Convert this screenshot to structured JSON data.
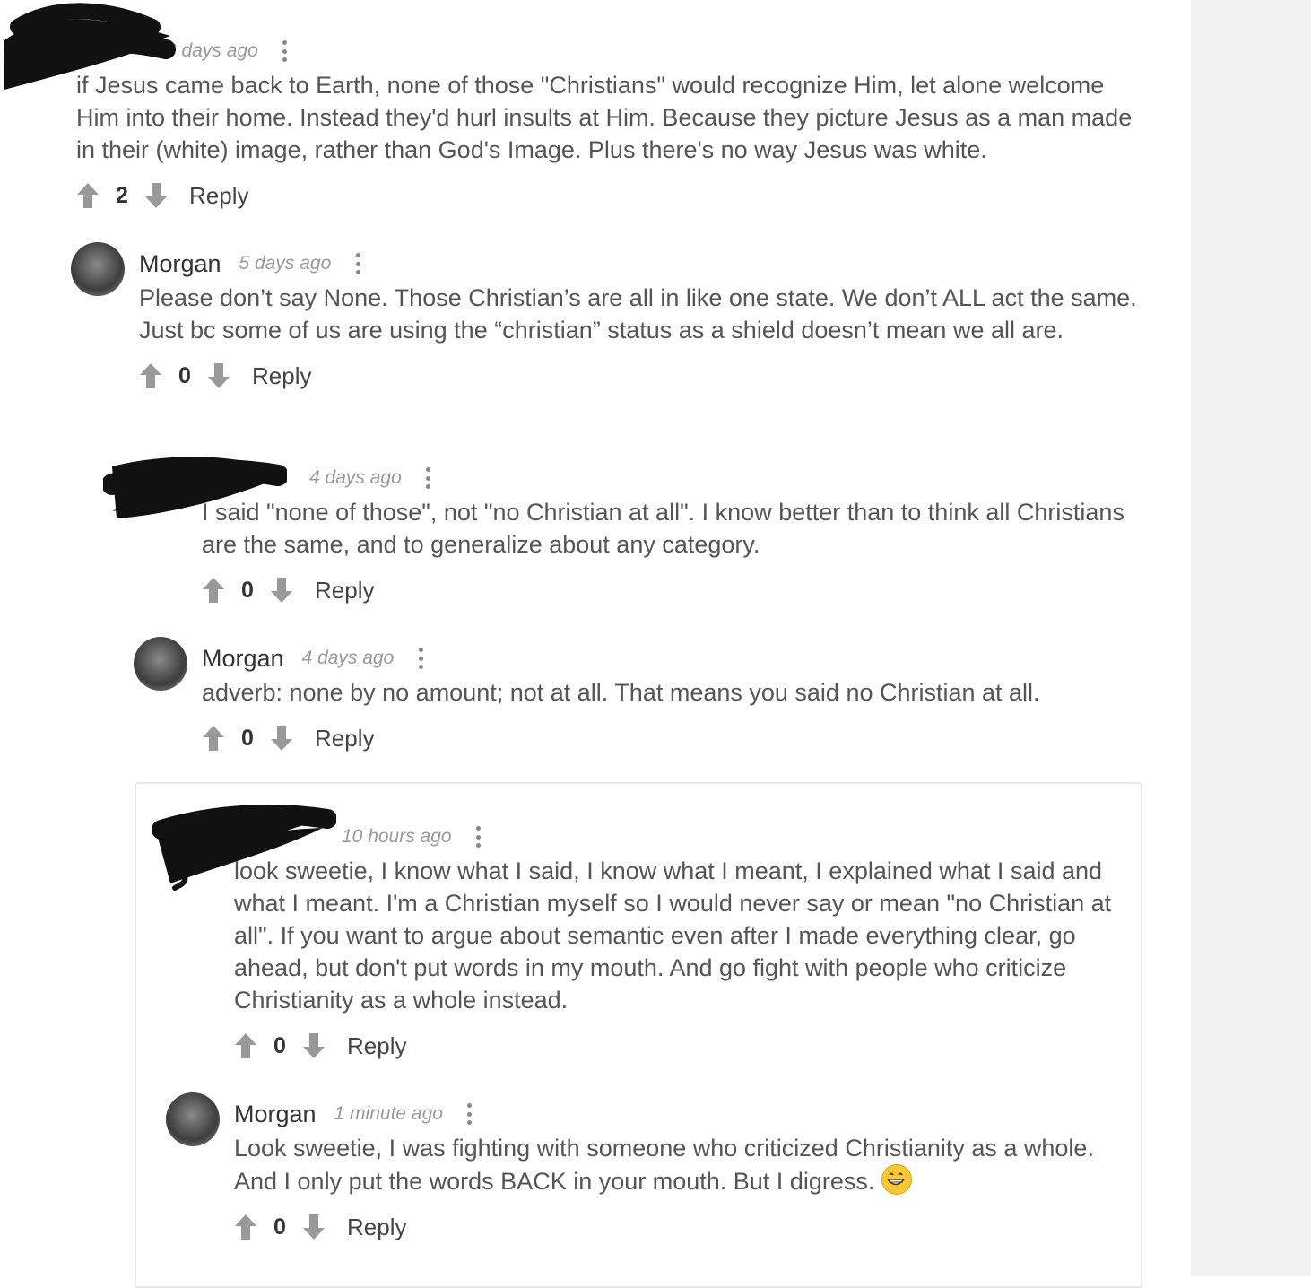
{
  "comments": [
    {
      "author": "",
      "time": "6 days ago",
      "body": "if Jesus came back to Earth, none of those \"Christians\" would recognize Him, let alone welcome Him into their home. Instead they'd hurl insults at Him. Because they picture Jesus as a man made in their (white) image, rather than God's Image. Plus there's no way Jesus was white.",
      "score": "2",
      "reply_label": "Reply"
    },
    {
      "author": "Morgan",
      "time": "5 days ago",
      "body": "Please don’t say None. Those Christian’s are all in like one state. We don’t ALL act the same. Just bc some of us are using the “christian” status as a shield doesn’t mean we all are.",
      "score": "0",
      "reply_label": "Reply"
    },
    {
      "author": "",
      "time": "4 days ago",
      "body": "I said \"none of those\", not \"no Christian at all\". I know better than to think all Christians are the same, and to generalize about any category.",
      "score": "0",
      "reply_label": "Reply"
    },
    {
      "author": "Morgan",
      "time": "4 days ago",
      "body": "adverb: none by no amount; not at all. That means you said no Christian at all.",
      "score": "0",
      "reply_label": "Reply"
    },
    {
      "author": "",
      "time": "10 hours ago",
      "body": "look sweetie, I know what I said, I know what I meant, I explained what I said and what I meant. I'm a Christian myself so I would never say or mean \"no Christian at all\". If you want to argue about semantic even after I made everything clear, go ahead, but don't put words in my mouth. And go fight with people who criticize Christianity as a whole instead.",
      "score": "0",
      "reply_label": "Reply"
    },
    {
      "author": "Morgan",
      "time": "1 minute ago",
      "body": "Look sweetie, I was fighting with someone who criticized Christianity as a whole. And I only put the words BACK in your mouth. But I digress.",
      "score": "0",
      "reply_label": "Reply"
    }
  ],
  "icons": {
    "upvote": "arrow-up-icon",
    "downvote": "arrow-down-icon",
    "more": "kebab-menu-icon",
    "emoji": "grinning-face-emoji"
  },
  "colors": {
    "text": "#555555",
    "author": "#333333",
    "meta": "#999999",
    "vote_arrow": "#999999",
    "side_panel": "#f2f2f2"
  }
}
